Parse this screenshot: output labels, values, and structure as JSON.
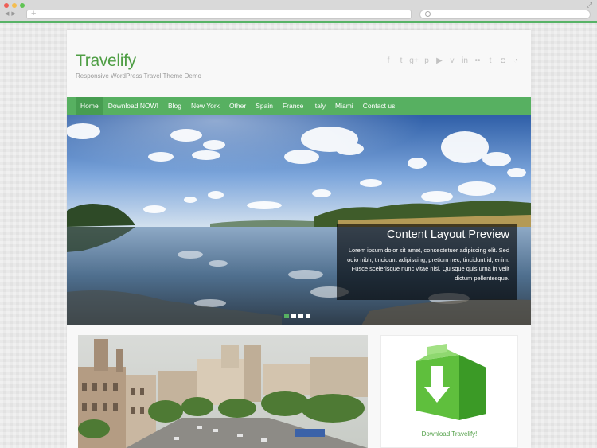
{
  "site": {
    "title": "Travelify",
    "tagline": "Responsive WordPress Travel Theme Demo"
  },
  "social_icons": [
    {
      "name": "facebook-icon",
      "glyph": "f"
    },
    {
      "name": "twitter-icon",
      "glyph": "t"
    },
    {
      "name": "google-plus-icon",
      "glyph": "g+"
    },
    {
      "name": "pinterest-icon",
      "glyph": "p"
    },
    {
      "name": "youtube-icon",
      "glyph": "▶"
    },
    {
      "name": "vimeo-icon",
      "glyph": "v"
    },
    {
      "name": "linkedin-icon",
      "glyph": "in"
    },
    {
      "name": "flickr-icon",
      "glyph": "••"
    },
    {
      "name": "tumblr-icon",
      "glyph": "t"
    },
    {
      "name": "instagram-icon",
      "glyph": "◘"
    },
    {
      "name": "rss-icon",
      "glyph": "◔"
    }
  ],
  "nav": {
    "items": [
      {
        "label": "Home",
        "active": true
      },
      {
        "label": "Download NOW!"
      },
      {
        "label": "Blog"
      },
      {
        "label": "New York"
      },
      {
        "label": "Other"
      },
      {
        "label": "Spain"
      },
      {
        "label": "France"
      },
      {
        "label": "Italy"
      },
      {
        "label": "Miami"
      },
      {
        "label": "Contact us"
      }
    ]
  },
  "slider": {
    "caption_title": "Content Layout Preview",
    "caption_text": "Lorem ipsum dolor sit amet, consectetuer adipiscing elit. Sed odio nibh, tincidunt adipiscing, pretium nec, tincidunt id, enim. Fusce scelerisque nunc vitae nisl. Quisque quis urna in velit dictum pellentesque.",
    "slide_count": 4,
    "active_slide": 1
  },
  "widget": {
    "download_label": "Download Travelify!"
  },
  "colors": {
    "accent": "#57b061",
    "title": "#4f9e45"
  }
}
